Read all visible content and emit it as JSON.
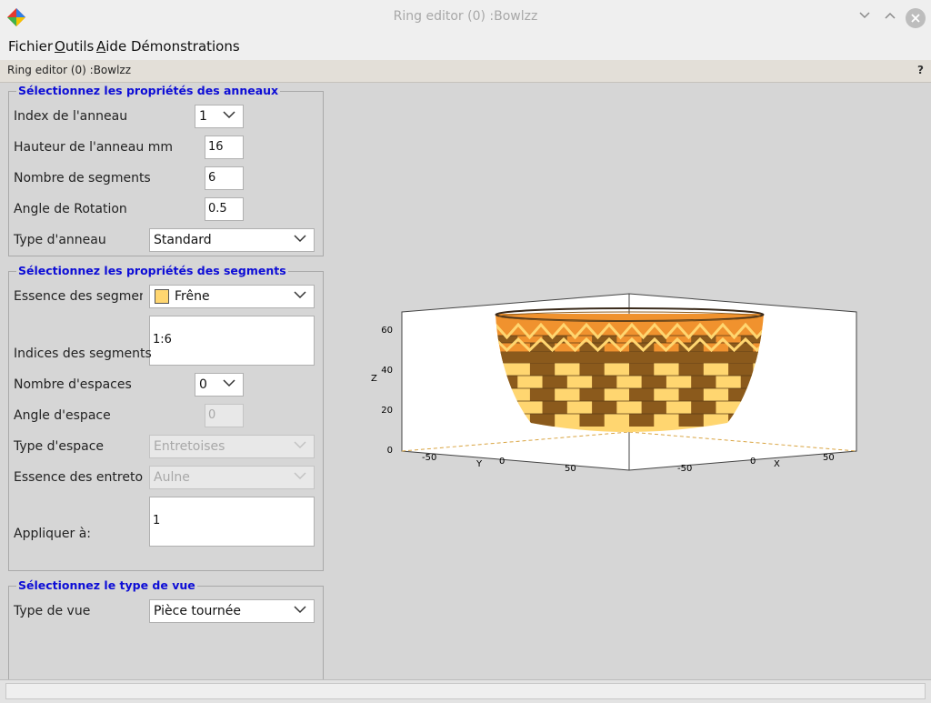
{
  "window": {
    "title": "Ring editor (0) :Bowlzz"
  },
  "menu": [
    "Fichier",
    "Outils",
    "Aide",
    "Démonstrations"
  ],
  "subtitle": "Ring editor (0) :Bowlzz",
  "help_label": "?",
  "ring_props": {
    "title": "Sélectionnez les propriétés des anneaux",
    "index_label": "Index de l'anneau",
    "index_value": "1",
    "height_label": "Hauteur de l'anneau mm",
    "height_value": "16",
    "segments_label": "Nombre de segments",
    "segments_value": "6",
    "rotation_label": "Angle de Rotation",
    "rotation_value": "0.5",
    "type_label": "Type d'anneau",
    "type_value": "Standard"
  },
  "segment_props": {
    "title": "Sélectionnez les propriétés des segments",
    "species_label": "Essence des segments",
    "species_value": "Frêne",
    "species_color": "#ffd670",
    "indices_label": "Indices des segments",
    "indices_value": "1:6",
    "spaces_label": "Nombre d'espaces",
    "spaces_value": "0",
    "space_angle_label": "Angle d'espace",
    "space_angle_value": "0",
    "space_type_label": "Type d'espace",
    "space_type_value": "Entretoises",
    "spacer_species_label": "Essence des entretoises",
    "spacer_species_value": "Aulne",
    "apply_label": "Appliquer à:",
    "apply_value": "1"
  },
  "view_props": {
    "title": "Sélectionnez le type de vue",
    "view_type_label": "Type de vue",
    "view_type_value": "Pièce tournée"
  },
  "chart_data": {
    "type": "3d-surface",
    "z_label": "Z",
    "y_label": "Y",
    "x_label": "X",
    "z_ticks": [
      "0",
      "20",
      "40",
      "60"
    ],
    "y_ticks": [
      "-50",
      "0",
      "50"
    ],
    "x_ticks": [
      "-50",
      "0",
      "50"
    ],
    "colors": {
      "light": "#ffd670",
      "dark": "#8b5a1c",
      "orange": "#f0922e"
    }
  }
}
